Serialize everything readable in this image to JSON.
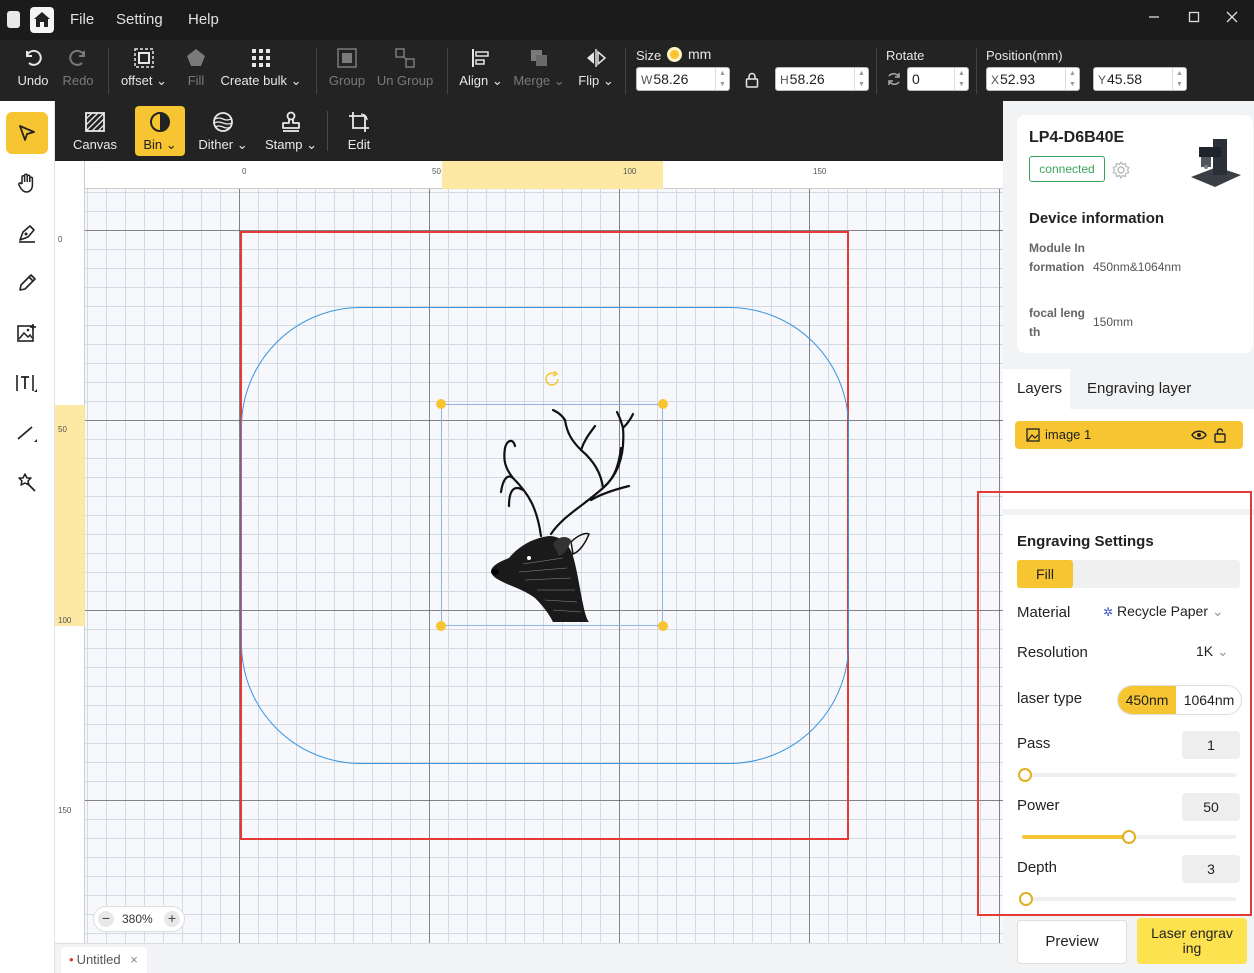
{
  "menu": [
    "File",
    "Setting",
    "Help"
  ],
  "toolbar": {
    "undo": "Undo",
    "redo": "Redo",
    "offset": "offset",
    "fill": "Fill",
    "create_bulk": "Create bulk",
    "group": "Group",
    "ungroup": "Un Group",
    "align": "Align",
    "merge": "Merge",
    "flip": "Flip",
    "size_label": "Size",
    "unit": "mm",
    "w_prefix": "W",
    "w_value": "58.26",
    "h_prefix": "H",
    "h_value": "58.26",
    "rotate_label": "Rotate",
    "rotate_value": "0",
    "position_label": "Position(mm)",
    "x_prefix": "X",
    "x_value": "52.93",
    "y_prefix": "Y",
    "y_value": "45.58",
    "chev": "v"
  },
  "subtoolbar": {
    "canvas": "Canvas",
    "bin": "Bin",
    "dither": "Dither",
    "stamp": "Stamp",
    "edit": "Edit"
  },
  "ruler": {
    "h": [
      "0",
      "50",
      "100",
      "150"
    ],
    "v": [
      "0",
      "50",
      "100",
      "150"
    ]
  },
  "canvas": {
    "zoom": "380%"
  },
  "document_tab": {
    "name": "Untitled",
    "close": "×"
  },
  "device": {
    "name": "LP4-D6B40E",
    "status": "connected",
    "info_heading": "Device information",
    "module_key": "Module Information",
    "module_val": "450nm&1064nm",
    "focal_key": "focal length",
    "focal_val": "150mm"
  },
  "tabs": {
    "layers": "Layers",
    "engraving_layer": "Engraving layer"
  },
  "layers": [
    {
      "name": "image 1"
    }
  ],
  "engraving": {
    "title": "Engraving Settings",
    "mode": "Fill",
    "material_label": "Material",
    "material_value": "Recycle Paper",
    "resolution_label": "Resolution",
    "resolution_value": "1K",
    "laser_label": "laser type",
    "laser_opt1": "450nm",
    "laser_opt2": "1064nm",
    "pass_label": "Pass",
    "pass_value": "1",
    "pass_level": 0,
    "power_label": "Power",
    "power_value": "50",
    "power_level": 0.5,
    "depth_label": "Depth",
    "depth_value": "3",
    "depth_level": 0.02
  },
  "buttons": {
    "preview": "Preview",
    "laser_engraving": "Laser engraving"
  },
  "colors": {
    "accent": "#f7c531",
    "workarea": "#e53935",
    "shape": "#3a96dd",
    "connected": "#3ca45b"
  }
}
